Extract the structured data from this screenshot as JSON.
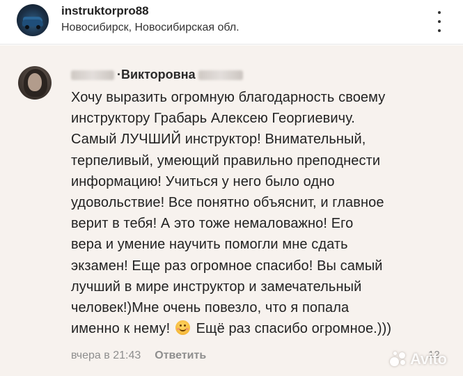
{
  "post_header": {
    "account_name": "instruktorpro88",
    "location": "Новосибирск, Новосибирская обл.",
    "more_icon": "more-vertical-icon"
  },
  "comment": {
    "author_visible": "·Викторовна",
    "lines": [
      "Хочу выразить огромную благодарность своему",
      "инструктору Грабарь Алексею Георгиевичу.",
      "Самый ЛУЧШИЙ инструктор! Внимательный,",
      "терпеливый, умеющий правильно преподнести",
      "информацию! Учиться у него было одно",
      "удовольствие! Все понятно объяснит, и главное",
      "верит в тебя! А это тоже немаловажно! Его",
      "вера и умение научить помогли мне сдать",
      "экзамен! Еще раз огромное спасибо! Вы самый",
      "лучший в мире инструктор и замечательный",
      "человек!)Мне очень повезло, что я попала"
    ],
    "last_line_before_emoji": "именно к нему!",
    "last_line_after_emoji": "Ещё раз спасибо огромное.)))",
    "emoji_icon": "smiling-face-icon",
    "timestamp": "вчера в 21:43",
    "reply_label": "Ответить",
    "like_count": "12"
  },
  "watermark": {
    "text": "Avito"
  },
  "colors": {
    "header_bg": "#ffffff",
    "comment_bg": "#f7f2ee",
    "text": "#222222",
    "muted": "#8e8e8e"
  }
}
